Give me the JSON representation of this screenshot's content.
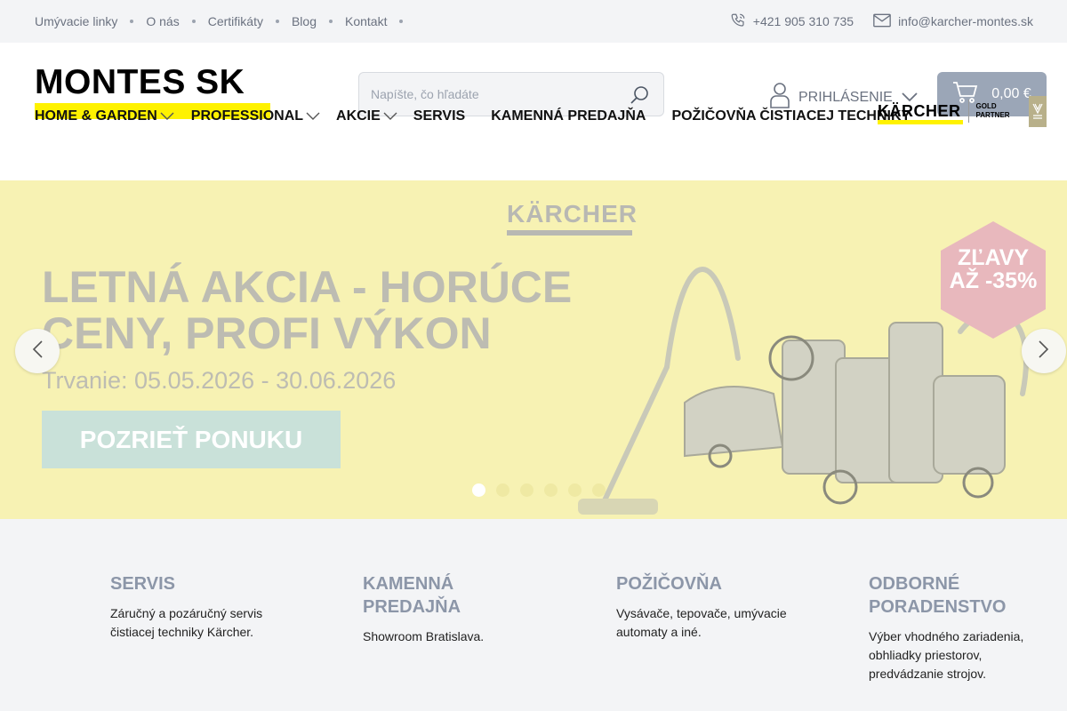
{
  "topbar": {
    "links": [
      "Umývacie linky",
      "O nás",
      "Certifikáty",
      "Blog",
      "Kontakt"
    ],
    "phone": "+421 905 310 735",
    "email": "info@karcher-montes.sk"
  },
  "header": {
    "logo_text": "MONTES SK",
    "search_placeholder": "Napíšte, čo hľadáte",
    "login_label": "PRIHLÁSENIE",
    "cart_amount": "0,00 €"
  },
  "nav": {
    "items": [
      {
        "label": "HOME & GARDEN"
      },
      {
        "label": "PROFESSIONAL"
      },
      {
        "label": "AKCIE"
      },
      {
        "label": "SERVIS"
      },
      {
        "label": "KAMENNÁ PREDAJŇA"
      },
      {
        "label": "POŽIČOVŇA ČISTIACEJ TECHNIKY"
      }
    ],
    "brand": "KÄRCHER",
    "brand_badge": "GOLD PARTNER"
  },
  "hero": {
    "brand": "KÄRCHER",
    "title": "LETNÁ AKCIA - HORÚCE CENY, PROFI VÝKON",
    "subtitle": "Trvanie: 05.05.2026 - 30.06.2026",
    "cta": "POZRIEŤ PONUKU",
    "badge": "ZĽAVY AŽ -35%",
    "slide_count": 6,
    "active_slide": 1
  },
  "features": [
    {
      "title": "SERVIS",
      "text": "Záručný a pozáručný servis čistiacej techniky Kärcher."
    },
    {
      "title": "KAMENNÁ PREDAJŇA",
      "text": "Showroom Bratislava."
    },
    {
      "title": "POŽIČOVŇA",
      "text": "Vysávače, tepovače, umývacie automaty a iné."
    },
    {
      "title": "ODBORNÉ PORADENSTVO",
      "text": "Výber vhodného zariadenia, obhliadky priestorov, predvádzanie strojov."
    }
  ],
  "colors": {
    "brand_yellow": "#fff200",
    "hero_bg": "#f7f2b3",
    "cart_bg": "#9ba6b7",
    "feature_title": "#8c96a8",
    "badge_pink": "#e8b8bd"
  }
}
